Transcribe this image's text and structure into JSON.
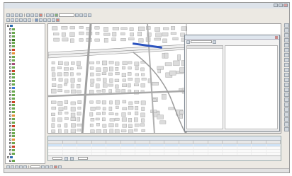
{
  "window": {
    "title": "",
    "menus": [
      "",
      "",
      "",
      "",
      "",
      "",
      "",
      "",
      ""
    ]
  },
  "scale": {
    "value": ""
  },
  "toc": {
    "layers": [
      {
        "label": "",
        "color": "#2b6cb0",
        "indent": false
      },
      {
        "label": "",
        "color": "#6aa84f",
        "indent": true
      },
      {
        "label": "",
        "color": "#6aa84f",
        "indent": true
      },
      {
        "label": "",
        "color": "#6aa84f",
        "indent": true
      },
      {
        "label": "",
        "color": "#38761d",
        "indent": true
      },
      {
        "label": "",
        "color": "#6aa84f",
        "indent": true
      },
      {
        "label": "",
        "color": "#6aa84f",
        "indent": true
      },
      {
        "label": "",
        "color": "#cc4125",
        "indent": true
      },
      {
        "label": "",
        "color": "#e69138",
        "indent": true
      },
      {
        "label": "",
        "color": "#6aa84f",
        "indent": true
      },
      {
        "label": "",
        "color": "#6aa84f",
        "indent": true
      },
      {
        "label": "",
        "color": "#a64d79",
        "indent": true
      },
      {
        "label": "",
        "color": "#6aa84f",
        "indent": true
      },
      {
        "label": "",
        "color": "#cc4125",
        "indent": true
      },
      {
        "label": "",
        "color": "#6aa84f",
        "indent": true
      },
      {
        "label": "",
        "color": "#6aa84f",
        "indent": true
      },
      {
        "label": "",
        "color": "#6aa84f",
        "indent": true
      },
      {
        "label": "",
        "color": "#6aa84f",
        "indent": true
      },
      {
        "label": "",
        "color": "#3c78d8",
        "indent": true
      },
      {
        "label": "",
        "color": "#6aa84f",
        "indent": true
      },
      {
        "label": "",
        "color": "#6aa84f",
        "indent": true
      },
      {
        "label": "",
        "color": "#6aa84f",
        "indent": true
      },
      {
        "label": "",
        "color": "#cc4125",
        "indent": true
      },
      {
        "label": "",
        "color": "#6aa84f",
        "indent": true
      },
      {
        "label": "",
        "color": "#6aa84f",
        "indent": true
      },
      {
        "label": "",
        "color": "#6aa84f",
        "indent": true
      },
      {
        "label": "",
        "color": "#e69138",
        "indent": true
      },
      {
        "label": "",
        "color": "#6aa84f",
        "indent": true
      },
      {
        "label": "",
        "color": "#6aa84f",
        "indent": true
      },
      {
        "label": "",
        "color": "#cc4125",
        "indent": true
      },
      {
        "label": "",
        "color": "#6aa84f",
        "indent": true
      },
      {
        "label": "",
        "color": "#6aa84f",
        "indent": true
      },
      {
        "label": "",
        "color": "#6aa84f",
        "indent": true
      },
      {
        "label": "",
        "color": "#e69138",
        "indent": true
      },
      {
        "label": "",
        "color": "#6aa84f",
        "indent": true
      },
      {
        "label": "",
        "color": "#cc4125",
        "indent": true
      },
      {
        "label": "",
        "color": "#6aa84f",
        "indent": true
      },
      {
        "label": "",
        "color": "#6aa84f",
        "indent": true
      },
      {
        "label": "",
        "color": "#2b6cb0",
        "indent": false
      },
      {
        "label": "",
        "color": "#6aa84f",
        "indent": true
      }
    ]
  },
  "attributes_window": {
    "title": "",
    "layer_select": "",
    "fields": [
      {
        "name": "",
        "value": ""
      },
      {
        "name": "",
        "value": ""
      },
      {
        "name": "",
        "value": ""
      },
      {
        "name": "",
        "value": ""
      },
      {
        "name": "",
        "value": ""
      },
      {
        "name": "",
        "value": ""
      },
      {
        "name": "",
        "value": ""
      },
      {
        "name": "",
        "value": ""
      },
      {
        "name": "",
        "value": ""
      },
      {
        "name": "",
        "value": ""
      },
      {
        "name": "",
        "value": ""
      },
      {
        "name": "",
        "value": ""
      },
      {
        "name": "",
        "value": ""
      },
      {
        "name": "",
        "value": ""
      },
      {
        "name": "",
        "value": ""
      },
      {
        "name": "",
        "value": ""
      },
      {
        "name": "",
        "value": ""
      },
      {
        "name": "",
        "value": ""
      },
      {
        "name": "",
        "value": ""
      },
      {
        "name": "",
        "value": ""
      },
      {
        "name": "",
        "value": ""
      },
      {
        "name": "",
        "value": ""
      },
      {
        "name": "",
        "value": ""
      },
      {
        "name": "",
        "value": ""
      },
      {
        "name": "",
        "value": ""
      },
      {
        "name": "",
        "value": ""
      },
      {
        "name": "",
        "value": ""
      },
      {
        "name": "",
        "value": ""
      }
    ]
  },
  "attribute_table": {
    "title": "",
    "columns": [
      "",
      "",
      "",
      "",
      "",
      "",
      "",
      "",
      "",
      "",
      "",
      "",
      "",
      "",
      "",
      ""
    ],
    "row_count": 5,
    "selected_row": 0,
    "footer": {
      "record_label": "",
      "show_label": ""
    }
  },
  "colors": {
    "highlight": "#2a52be",
    "road": "#b5b5b5",
    "building": "#d6d6d6",
    "selection_row": "#cfe3f7"
  }
}
